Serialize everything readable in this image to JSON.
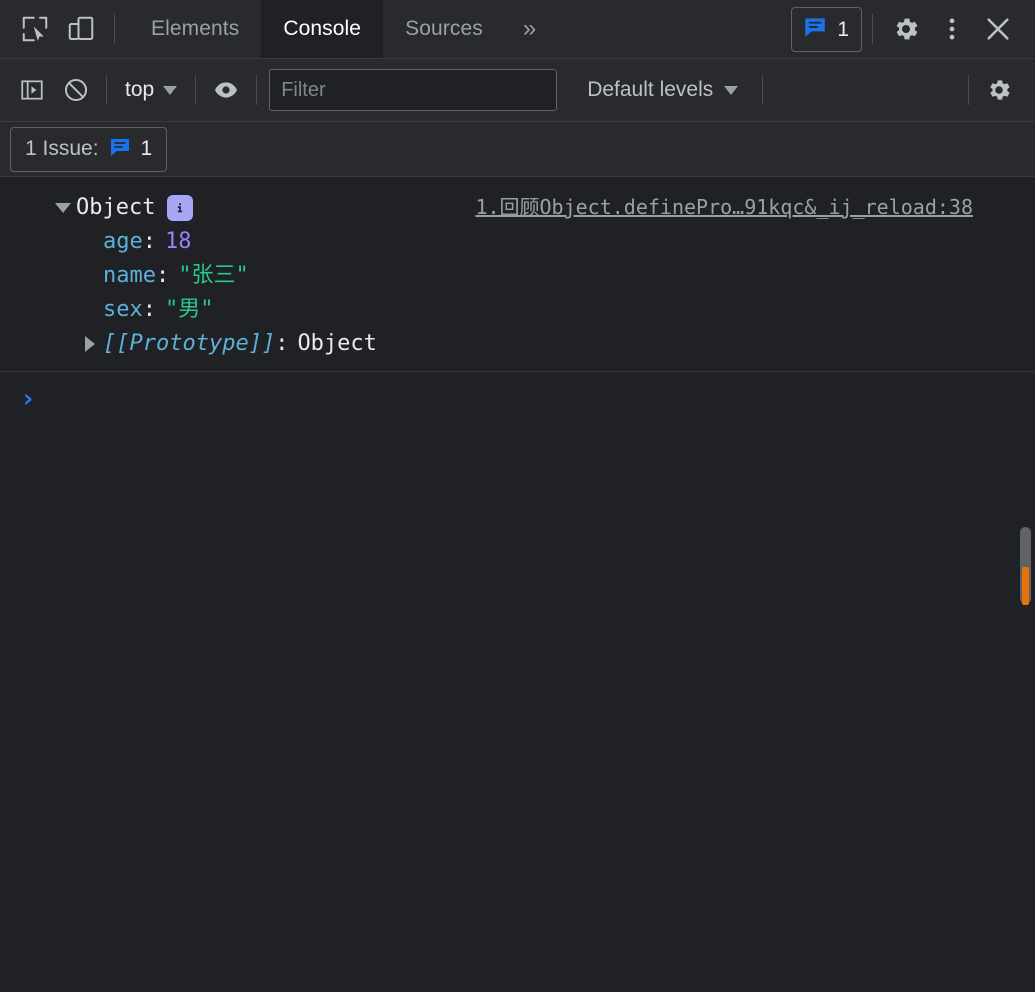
{
  "window": {
    "theme_bg": "#202124",
    "toolbar_bg": "#292a2d",
    "accent_blue": "#1a73e8",
    "accent_orange": "#e8710a"
  },
  "tabbar": {
    "inspect_icon": "inspect-element-icon",
    "device_icon": "device-toolbar-icon",
    "tabs": [
      {
        "label": "Elements",
        "active": false
      },
      {
        "label": "Console",
        "active": true
      },
      {
        "label": "Sources",
        "active": false
      }
    ],
    "more_tabs_label": "»",
    "issues_count": "1",
    "issues_icon": "issue-bubble-icon",
    "settings_icon": "gear-icon",
    "more_icon": "kebab-menu-icon",
    "close_icon": "close-icon"
  },
  "console_toolbar": {
    "sidebar_toggle_icon": "console-sidebar-icon",
    "clear_icon": "clear-console-icon",
    "context_label": "top",
    "eye_icon": "live-expression-eye-icon",
    "filter_placeholder": "Filter",
    "filter_value": "",
    "levels_label": "Default levels",
    "settings_icon": "console-settings-gear-icon"
  },
  "issues_bar": {
    "label": "1 Issue:",
    "count": "1",
    "icon": "issue-bubble-icon"
  },
  "console": {
    "message": {
      "source_link": "1.回顾Object.definePro…91kqc&_ij_reload:38",
      "object_label": "Object",
      "info_badge_glyph": "i",
      "properties": [
        {
          "key": "age",
          "separator": ":",
          "value": "18",
          "kind": "number"
        },
        {
          "key": "name",
          "separator": ":",
          "value": "\"张三\"",
          "kind": "string"
        },
        {
          "key": "sex",
          "separator": ":",
          "value": "\"男\"",
          "kind": "string"
        }
      ],
      "prototype_key": "[[Prototype]]",
      "prototype_separator": ":",
      "prototype_value": "Object"
    },
    "prompt_glyph": "›"
  }
}
